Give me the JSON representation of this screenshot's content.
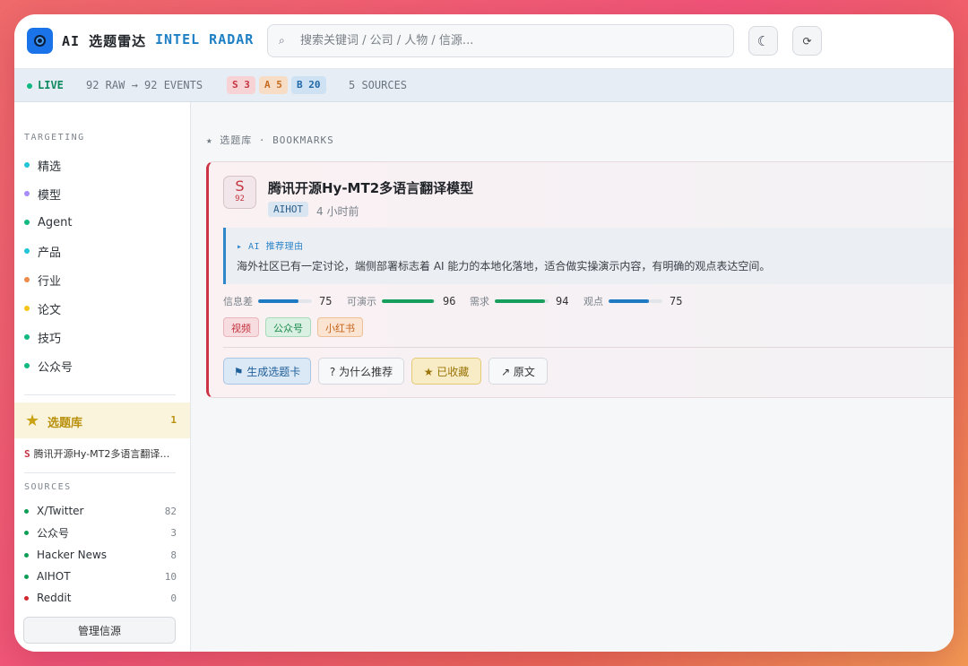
{
  "app": {
    "title_cn": "AI 选题雷达",
    "title_en": "INTEL RADAR"
  },
  "search": {
    "placeholder": "搜索关键词 / 公司 / 人物 / 信源...",
    "value": ""
  },
  "header": {
    "theme_icon": "☾",
    "refresh_icon": "⟳"
  },
  "status": {
    "live": "LIVE",
    "events": "92 RAW → 92 EVENTS",
    "tiers": [
      {
        "label": "S 3"
      },
      {
        "label": "A 5"
      },
      {
        "label": "B 20"
      }
    ],
    "sources": "5 SOURCES"
  },
  "sidebar": {
    "targeting_title": "TARGETING",
    "items": [
      {
        "label": "精选",
        "color": "#22c5d8"
      },
      {
        "label": "模型",
        "color": "#a78bfa"
      },
      {
        "label": "Agent",
        "color": "#10b981"
      },
      {
        "label": "产品",
        "color": "#22c5d8"
      },
      {
        "label": "行业",
        "color": "#f08a4b"
      },
      {
        "label": "论文",
        "color": "#f5c518"
      },
      {
        "label": "技巧",
        "color": "#10b981"
      },
      {
        "label": "公众号",
        "color": "#10b981"
      }
    ],
    "bookmark": {
      "icon": "★",
      "label": "选题库",
      "count": "1"
    },
    "bookmark_items": [
      {
        "tier": "S",
        "title": "腾讯开源Hy-MT2多语言翻译…"
      }
    ],
    "sources_title": "SOURCES",
    "sources": [
      {
        "label": "X/Twitter",
        "count": "82",
        "color": "#0f9d58"
      },
      {
        "label": "公众号",
        "count": "3",
        "color": "#0f9d58"
      },
      {
        "label": "Hacker News",
        "count": "8",
        "color": "#0f9d58"
      },
      {
        "label": "AIHOT",
        "count": "10",
        "color": "#0f9d58"
      },
      {
        "label": "Reddit",
        "count": "0",
        "color": "#d0282f"
      }
    ],
    "manage_label": "管理信源"
  },
  "main": {
    "breadcrumb": "★  选题库  ·  BOOKMARKS",
    "card": {
      "tier": "S",
      "score": "92",
      "title": "腾讯开源Hy-MT2多语言翻译模型",
      "source": "AIHOT",
      "time": "4 小时前",
      "reason_label": "▸ AI 推荐理由",
      "reason_text": "海外社区已有一定讨论，端侧部署标志着 AI 能力的本地化落地，适合做实操演示内容，有明确的观点表达空间。",
      "metrics": [
        {
          "label": "信息差",
          "value": "75",
          "color": "#1f7ac4"
        },
        {
          "label": "可演示",
          "value": "96",
          "color": "#17a05d"
        },
        {
          "label": "需求",
          "value": "94",
          "color": "#17a05d"
        },
        {
          "label": "观点",
          "value": "75",
          "color": "#1f7ac4"
        }
      ],
      "tags": [
        {
          "label": "视频"
        },
        {
          "label": "公众号"
        },
        {
          "label": "小红书"
        }
      ],
      "actions": {
        "generate": "⚑ 生成选题卡",
        "why": "? 为什么推荐",
        "saved": "★ 已收藏",
        "original": "↗ 原文"
      }
    }
  }
}
